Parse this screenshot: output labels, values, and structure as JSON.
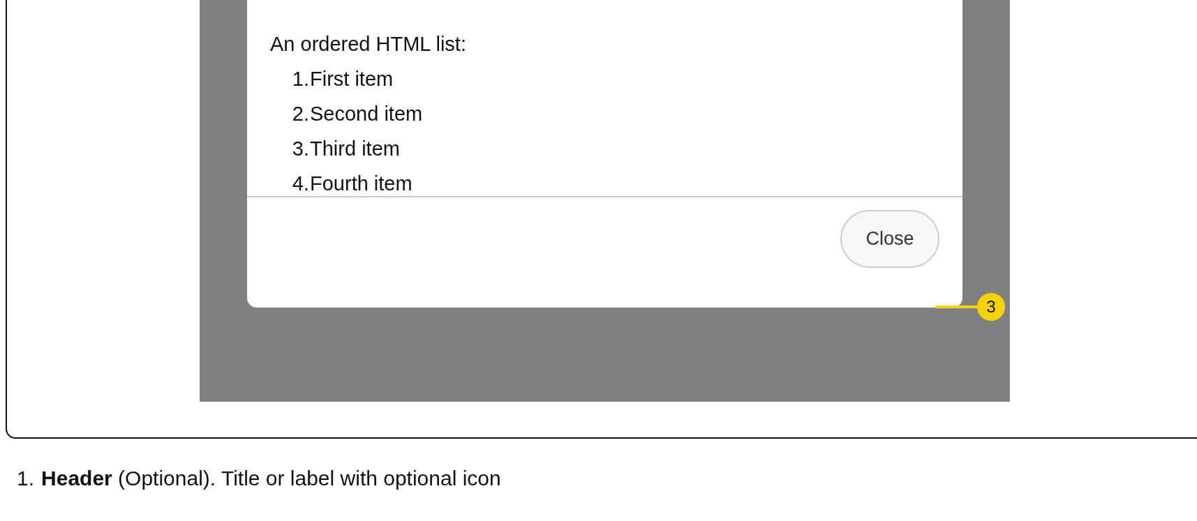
{
  "dialog": {
    "intro": "An ordered HTML list:",
    "items": [
      {
        "number": "1.",
        "label": "First item"
      },
      {
        "number": "2.",
        "label": "Second item"
      },
      {
        "number": "3.",
        "label": "Third item"
      },
      {
        "number": "4.",
        "label": "Fourth item"
      }
    ],
    "close_button": "Close"
  },
  "callout": {
    "number": "3"
  },
  "notes": [
    {
      "number": "1.",
      "text": "**Header** (Optional). Title or label with optional icon"
    }
  ]
}
